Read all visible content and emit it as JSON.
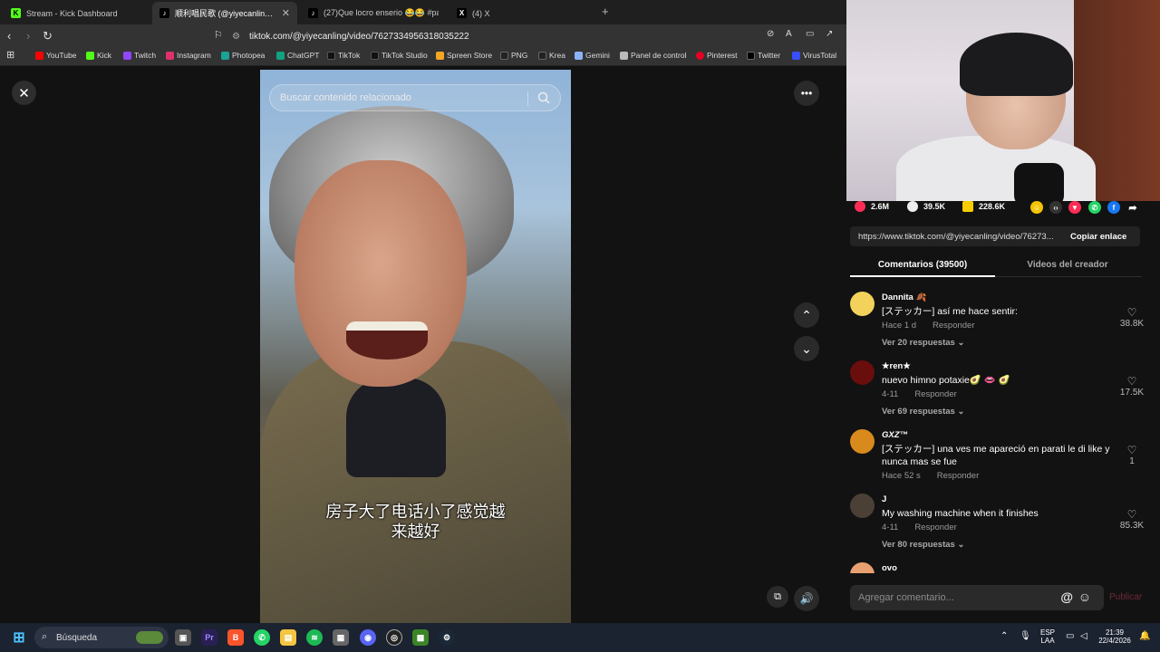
{
  "browser": {
    "tabs": [
      {
        "label": "Stream - Kick Dashboard",
        "icon": "kick-icon",
        "active": false
      },
      {
        "label": "顺利唱民歌 (@yiyecanling) | TikTok",
        "icon": "tiktok-icon",
        "active": true
      },
      {
        "label": "(27)Que locro enserio 😂😂 #parag",
        "icon": "tiktok-icon",
        "active": false
      },
      {
        "label": "(4) X",
        "icon": "x-icon",
        "active": false
      }
    ],
    "new_tab": "+",
    "url": "tiktok.com/@yiyecanling/video/7627334956318035222",
    "bookmarks": [
      {
        "label": "YouTube",
        "color": "#ff0000"
      },
      {
        "label": "Kick",
        "color": "#53fc18"
      },
      {
        "label": "Twitch",
        "color": "#9146ff"
      },
      {
        "label": "Instagram",
        "color": "#e1306c"
      },
      {
        "label": "Photopea",
        "color": "#18a497"
      },
      {
        "label": "ChatGPT",
        "color": "#10a37f"
      },
      {
        "label": "TikTok",
        "color": "#111111"
      },
      {
        "label": "TikTok Studio",
        "color": "#111111"
      },
      {
        "label": "Spreen Store",
        "color": "#f5a623"
      },
      {
        "label": "PNG",
        "color": "#222222"
      },
      {
        "label": "Krea",
        "color": "#222222"
      },
      {
        "label": "Gemini",
        "color": "#8ab4f8"
      },
      {
        "label": "Panel de control",
        "color": "#bbbbbb"
      },
      {
        "label": "Pinterest",
        "color": "#e60023"
      },
      {
        "label": "Twitter",
        "color": "#000000"
      },
      {
        "label": "VirusTotal",
        "color": "#394eff"
      }
    ]
  },
  "video": {
    "search_placeholder": "Buscar contenido relacionado",
    "subtitle_line1": "房子大了电话小了感觉越",
    "subtitle_line2": "来越好"
  },
  "stats": {
    "likes": "2.6M",
    "comments": "39.5K",
    "saves": "228.6K"
  },
  "link": {
    "url": "https://www.tiktok.com/@yiyecanling/video/76273...",
    "copy_label": "Copiar enlace"
  },
  "panel_tabs": {
    "comments": "Comentarios (39500)",
    "creator_videos": "Videos del creador"
  },
  "comments": [
    {
      "user": "Dannita 🍂",
      "text": "[ステッカー] así me hace sentir:",
      "time": "Hace 1 d",
      "reply": "Responder",
      "likes": "38.8K",
      "replies": "Ver 20 respuestas ⌄",
      "avatar_color": "#f2d25a"
    },
    {
      "user": "★ren★",
      "text": "nuevo himno potaxie🥑 👄 🥑",
      "time": "4-11",
      "reply": "Responder",
      "likes": "17.5K",
      "replies": "Ver 69 respuestas ⌄",
      "avatar_color": "#6a0d0d"
    },
    {
      "user": "GXZ™",
      "text": "[ステッカー] una ves me apareció en parati le di like y nunca mas se fue",
      "time": "Hace 52 s",
      "reply": "Responder",
      "likes": "1",
      "replies": "",
      "avatar_color": "#d98a1c"
    },
    {
      "user": "J",
      "text": "My washing machine when it finishes",
      "time": "4-11",
      "reply": "Responder",
      "likes": "85.3K",
      "replies": "Ver 80 respuestas ⌄",
      "avatar_color": "#4a4036"
    },
    {
      "user": "ovo",
      "text": "",
      "time": "",
      "reply": "",
      "likes": "",
      "replies": "",
      "avatar_color": "#e8a070"
    }
  ],
  "comment_input": {
    "placeholder": "Agregar comentario...",
    "publish": "Publicar"
  },
  "taskbar": {
    "search": "Búsqueda",
    "lang_top": "ESP",
    "lang_bottom": "LAA",
    "time": "21:39",
    "date": "22/4/2026"
  }
}
